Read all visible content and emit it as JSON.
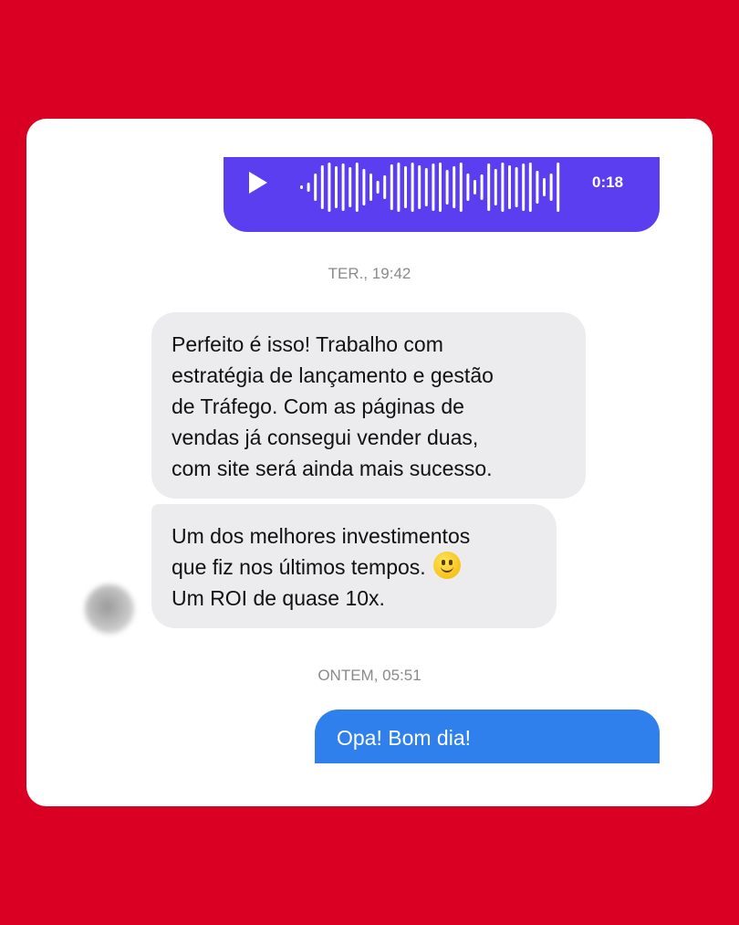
{
  "conversation": {
    "audio_message": {
      "duration": "0:18",
      "play_icon": "play-icon"
    },
    "timestamps": {
      "first": "TER., 19:42",
      "second": "ONTEM, 05:51"
    },
    "received": [
      {
        "lines": [
          "Perfeito é isso! Trabalho com",
          "estratégia de lançamento e gestão",
          "de Tráfego. Com as páginas de",
          "vendas já consegui vender duas,",
          "com site será ainda mais sucesso."
        ]
      },
      {
        "lines": [
          "Um dos melhores investimentos",
          "que fiz nos últimos tempos.",
          "Um ROI de quase 10x."
        ],
        "emoji": "slightly-smiling-face-icon"
      }
    ],
    "sent": {
      "text": "Opa! Bom dia!"
    }
  },
  "colors": {
    "background": "#d90024",
    "card": "#ffffff",
    "audio_bubble": "#5b3ef0",
    "received_bubble": "#ececee",
    "sent_bubble": "#2f80ed",
    "timestamp_text": "#8a8a8e"
  }
}
